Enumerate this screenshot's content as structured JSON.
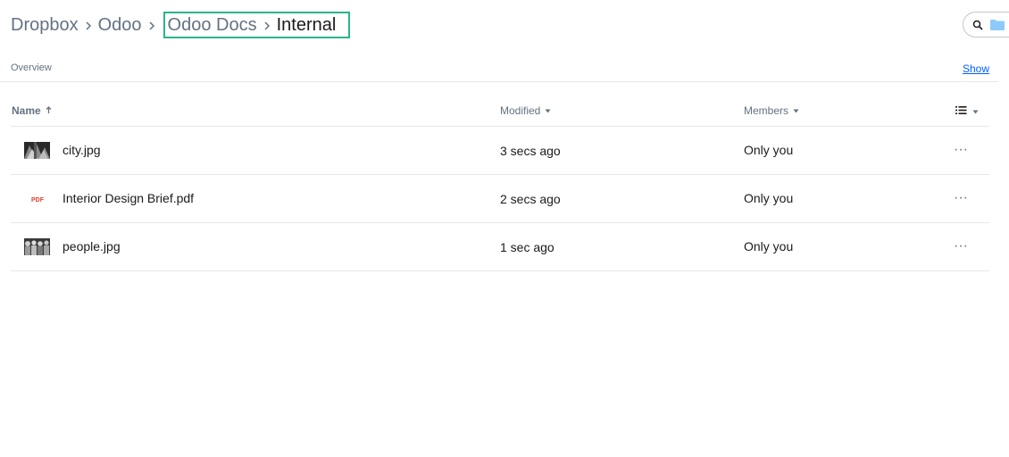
{
  "breadcrumb": {
    "items": [
      {
        "label": "Dropbox"
      },
      {
        "label": "Odoo"
      },
      {
        "label": "Odoo Docs"
      },
      {
        "label": "Internal"
      }
    ]
  },
  "search": {
    "icon": "search-icon",
    "folder_icon": "folder-icon"
  },
  "overview": {
    "label": "Overview",
    "show_link": "Show"
  },
  "table": {
    "columns": {
      "name": "Name",
      "modified": "Modified",
      "members": "Members"
    },
    "rows": [
      {
        "thumb": "city-image-thumbnail",
        "name": "city.jpg",
        "modified": "3 secs ago",
        "members": "Only you"
      },
      {
        "thumb": "pdf-file-icon",
        "thumb_text": "PDF",
        "name": "Interior Design Brief.pdf",
        "modified": "2 secs ago",
        "members": "Only you"
      },
      {
        "thumb": "people-image-thumbnail",
        "name": "people.jpg",
        "modified": "1 sec ago",
        "members": "Only you"
      }
    ],
    "more_label": "···"
  },
  "colors": {
    "highlight_border": "#2bb38a",
    "link": "#0061fe",
    "muted_text": "#637282",
    "pdf_red": "#e03e2d",
    "folder_blue": "#8ecaf9"
  }
}
